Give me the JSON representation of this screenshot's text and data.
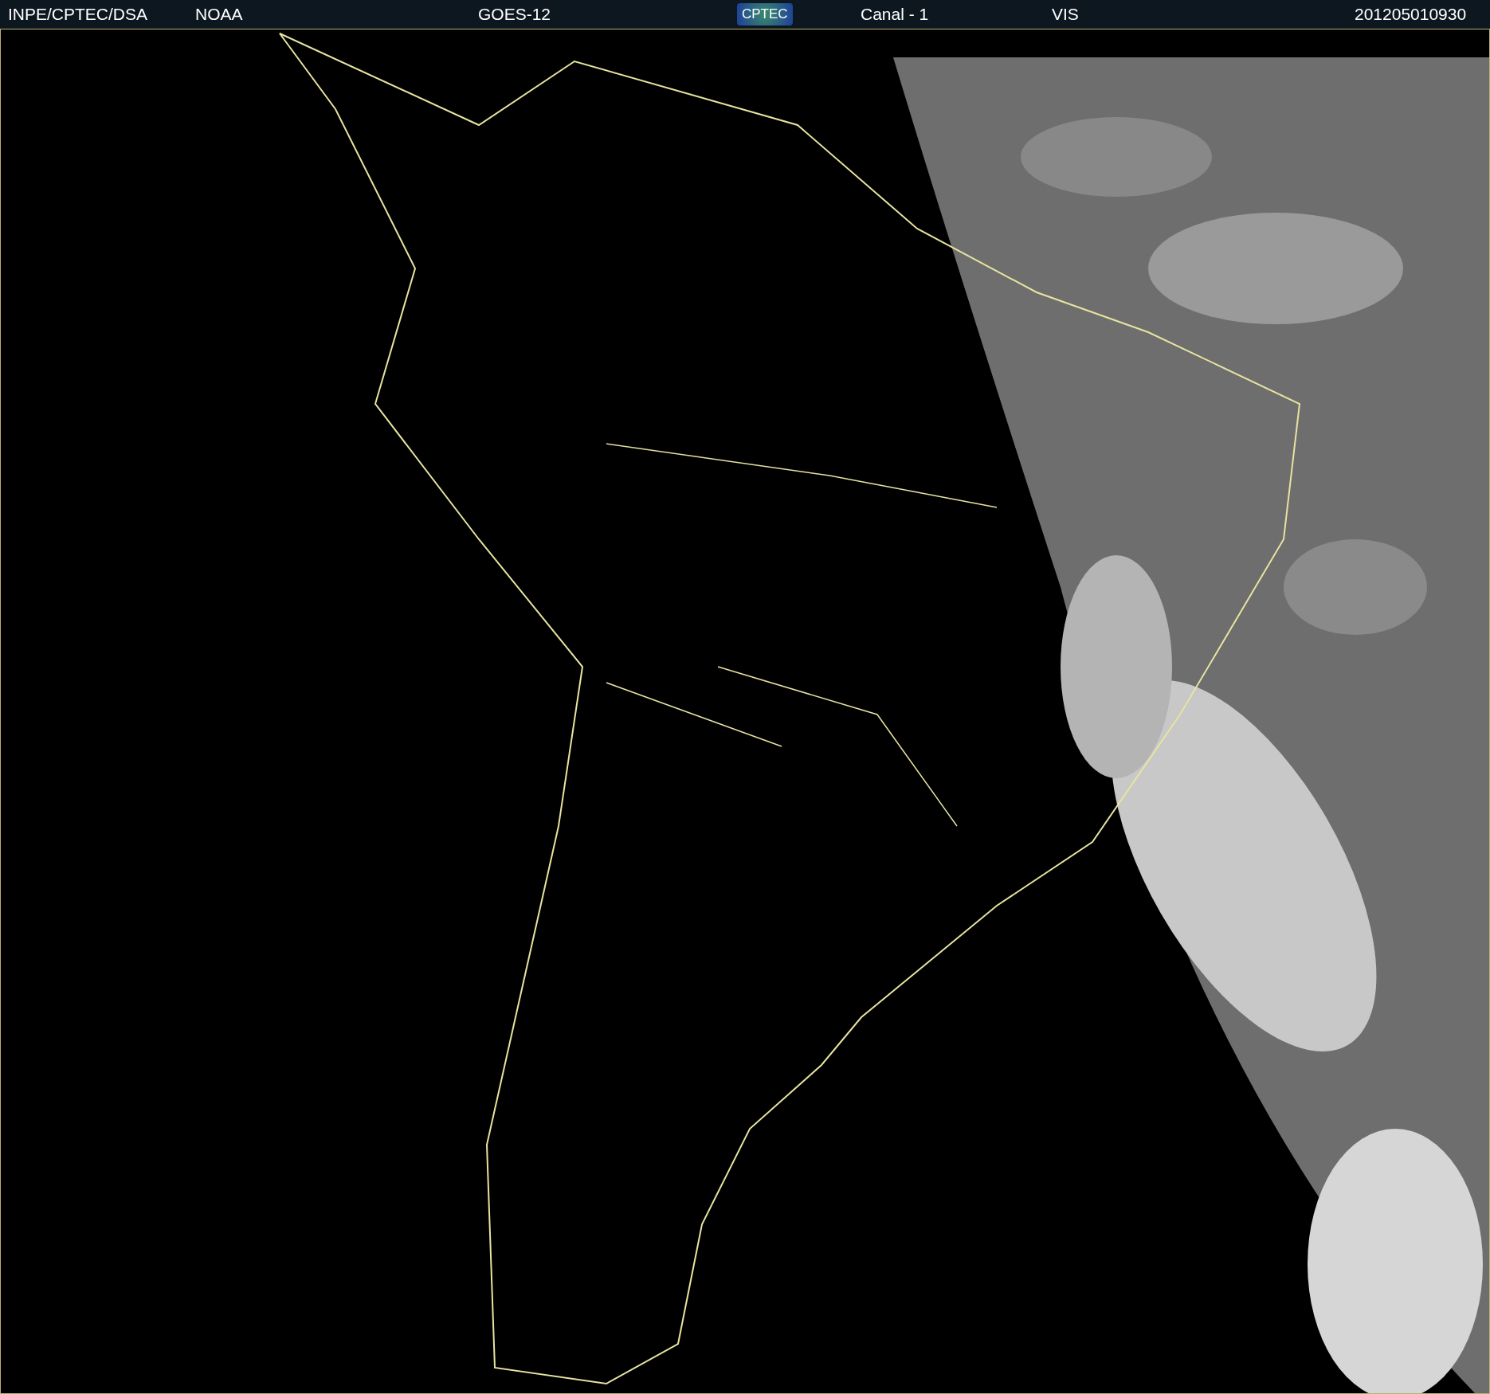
{
  "header": {
    "items": [
      {
        "kind": "text",
        "text": "INPE/CPTEC/DSA"
      },
      {
        "kind": "text",
        "text": "NOAA"
      },
      {
        "kind": "text",
        "text": "GOES-12"
      },
      {
        "kind": "logo",
        "text": "CPTEC"
      },
      {
        "kind": "text",
        "text": "Canal - 1"
      },
      {
        "kind": "text",
        "text": "VIS"
      },
      {
        "kind": "text",
        "text": "201205010930"
      }
    ]
  }
}
